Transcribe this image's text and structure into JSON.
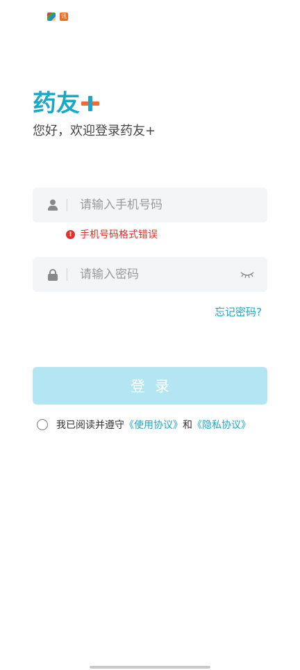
{
  "status_bar": {
    "icons": [
      "multicolor-app-icon",
      "orange-app-icon"
    ],
    "orange_icon_text": "讯"
  },
  "logo": {
    "text": "药友",
    "accent_colors": {
      "blue": "#1aa8c8",
      "orange": "#f26b2c"
    }
  },
  "welcome_text": "您好，欢迎登录药友+",
  "phone_field": {
    "placeholder": "请输入手机号码",
    "value": ""
  },
  "phone_error": "手机号码格式错误",
  "password_field": {
    "placeholder": "请输入密码",
    "value": ""
  },
  "forgot_password": "忘记密码?",
  "login_button": "登录",
  "agreement": {
    "prefix": "我已阅读并遵守",
    "terms_link": "《使用协议》",
    "conjunction": "和",
    "privacy_link": "《隐私协议》",
    "checked": false
  },
  "colors": {
    "primary": "#1aa8c8",
    "error": "#d9312a",
    "button_disabled": "#b4e5f3",
    "field_bg": "#f4f5f7"
  }
}
